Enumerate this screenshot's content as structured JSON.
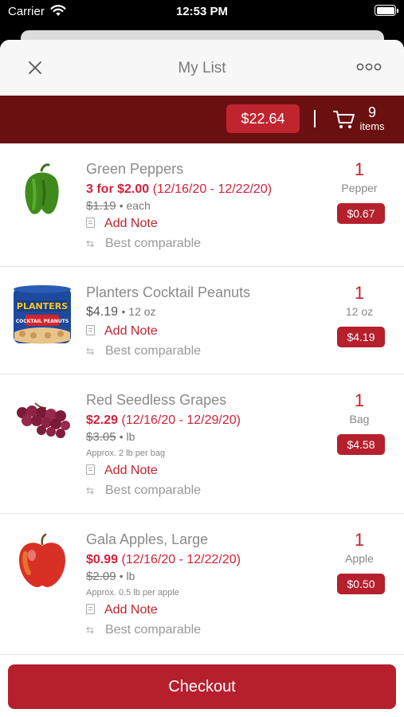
{
  "status_bar": {
    "carrier": "Carrier",
    "time": "12:53 PM"
  },
  "nav": {
    "title": "My List"
  },
  "summary": {
    "total": "$22.64",
    "item_count": "9",
    "item_count_label": "items"
  },
  "items": [
    {
      "name": "Green Peppers",
      "price": "3 for $2.00",
      "dates": "(12/16/20 - 12/22/20)",
      "original_price": "$1.19",
      "unit": "each",
      "approx": "",
      "note_label": "Add Note",
      "comparable_label": "Best comparable",
      "quantity": "1",
      "quantity_unit": "Pepper",
      "line_total": "$0.67",
      "icon": "green-pepper-image"
    },
    {
      "name": "Planters Cocktail Peanuts",
      "price": "$4.19",
      "unit": "12 oz",
      "note_label": "Add Note",
      "comparable_label": "Best comparable",
      "quantity": "1",
      "quantity_unit": "12 oz",
      "line_total": "$4.19",
      "icon": "peanuts-can-image",
      "logo_text": "PLANTERS",
      "product_text": "COCKTAIL PEANUTS"
    },
    {
      "name": "Red Seedless Grapes",
      "price": "$2.29",
      "dates": "(12/16/20 - 12/29/20)",
      "original_price": "$3.05",
      "unit": "lb",
      "approx": "Approx. 2 lb per bag",
      "note_label": "Add Note",
      "comparable_label": "Best comparable",
      "quantity": "1",
      "quantity_unit": "Bag",
      "line_total": "$4.58",
      "icon": "grapes-image"
    },
    {
      "name": "Gala Apples, Large",
      "price": "$0.99",
      "dates": "(12/16/20 - 12/22/20)",
      "original_price": "$2.09",
      "unit": "lb",
      "approx": "Approx. 0.5 lb per apple",
      "note_label": "Add Note",
      "comparable_label": "Best comparable",
      "quantity": "1",
      "quantity_unit": "Apple",
      "line_total": "$0.50",
      "icon": "apple-image"
    }
  ],
  "checkout": {
    "label": "Checkout"
  },
  "colors": {
    "brand_red": "#b5202c",
    "header_dark_red": "#6b1010",
    "sale_red": "#d4213a"
  }
}
